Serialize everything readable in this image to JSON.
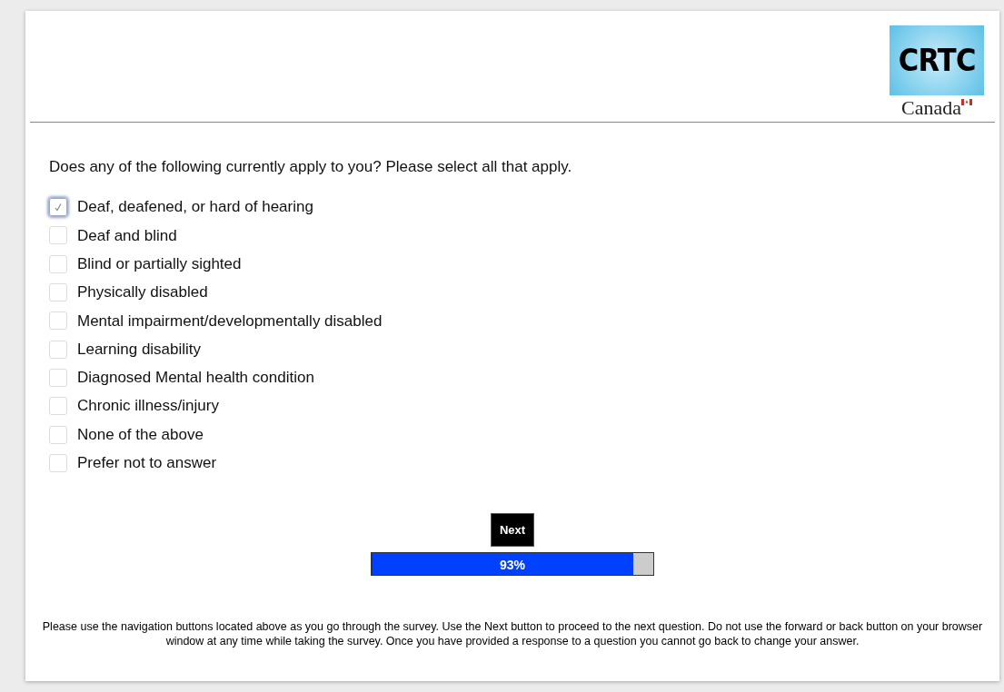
{
  "logo": {
    "acronym": "CRTC",
    "wordmark": "Canada"
  },
  "question": "Does any of the following currently apply to you? Please select all that apply.",
  "options": [
    {
      "label": "Deaf, deafened, or hard of hearing",
      "checked": true
    },
    {
      "label": "Deaf and blind",
      "checked": false
    },
    {
      "label": "Blind or partially sighted",
      "checked": false
    },
    {
      "label": "Physically disabled",
      "checked": false
    },
    {
      "label": "Mental impairment/developmentally disabled",
      "checked": false
    },
    {
      "label": "Learning disability",
      "checked": false
    },
    {
      "label": "Diagnosed Mental health condition",
      "checked": false
    },
    {
      "label": "Chronic illness/injury",
      "checked": false
    },
    {
      "label": "None of the above",
      "checked": false
    },
    {
      "label": "Prefer not to answer",
      "checked": false
    }
  ],
  "next_button": "Next",
  "progress": {
    "level": 0.93,
    "reading": "93%"
  },
  "footer": "Please use the navigation buttons located above as you go through the survey. Use the Next button to proceed to the next question. Do not use the forward or back button on your browser window at any time while taking the survey. Once you have provided a response to a question you cannot go back to change your answer."
}
